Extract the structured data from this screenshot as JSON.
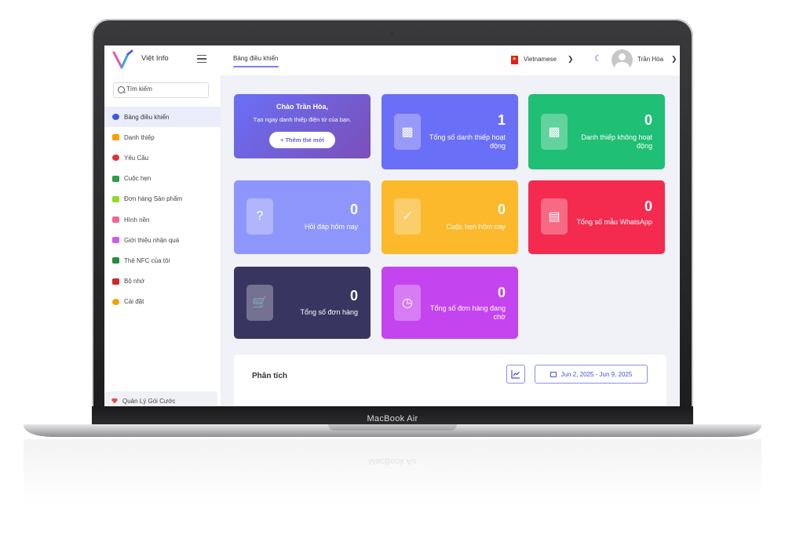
{
  "device": {
    "label": "MacBook Air"
  },
  "topbar": {
    "app_name": "Việt Info",
    "breadcrumb": "Bảng điều khiển",
    "language": "Vietnamese",
    "user_name": "Trần Hòa"
  },
  "sidebar": {
    "search_placeholder": "Tìm kiếm",
    "items": [
      {
        "label": "Bảng điều khiển",
        "icon": "dashboard-icon",
        "color": "#3b5bdb",
        "active": true
      },
      {
        "label": "Danh thiếp",
        "icon": "card-icon",
        "color": "#f59f00"
      },
      {
        "label": "Yêu Cầu",
        "icon": "request-icon",
        "color": "#e03131"
      },
      {
        "label": "Cuộc hẹn",
        "icon": "calendar-icon",
        "color": "#2f9e44"
      },
      {
        "label": "Đơn hàng Sản phẩm",
        "icon": "order-icon",
        "color": "#94d82d"
      },
      {
        "label": "Hình nền",
        "icon": "wallpaper-icon",
        "color": "#f06595"
      },
      {
        "label": "Giới thiệu nhận quà",
        "icon": "gift-icon",
        "color": "#cc5de8"
      },
      {
        "label": "Thẻ NFC của tôi",
        "icon": "nfc-icon",
        "color": "#2b8a3e"
      },
      {
        "label": "Bộ nhớ",
        "icon": "storage-icon",
        "color": "#c92a2a"
      },
      {
        "label": "Cài đặt",
        "icon": "settings-icon",
        "color": "#f59f00"
      }
    ],
    "plan_label": "Quản Lý Gói Cước"
  },
  "welcome": {
    "title": "Chào Trần Hòa,",
    "subtitle": "Tạo ngay danh thiếp điện tử của bạn.",
    "button": "+ Thêm thẻ mới",
    "color": "#6a63d8"
  },
  "stats": [
    {
      "value": "1",
      "label": "Tổng số danh thiếp hoạt động",
      "icon": "id-badge-icon",
      "color": "#6a6ff7"
    },
    {
      "value": "0",
      "label": "Danh thiếp không hoạt động",
      "icon": "id-badge-icon",
      "color": "#1fbf75"
    },
    {
      "value": "0",
      "label": "Hỏi đáp hôm nay",
      "icon": "question-icon",
      "color": "#8f96fb"
    },
    {
      "value": "0",
      "label": "Cuộc hẹn hôm nay",
      "icon": "calendar-check-icon",
      "color": "#fbb92b"
    },
    {
      "value": "0",
      "label": "Tổng số mẫu WhatsApp",
      "icon": "document-icon",
      "color": "#f52a4f"
    },
    {
      "value": "0",
      "label": "Tổng số đơn hàng",
      "icon": "cart-icon",
      "color": "#383660"
    },
    {
      "value": "0",
      "label": "Tổng số đơn hàng đang chờ",
      "icon": "clock-icon",
      "color": "#c445f0"
    }
  ],
  "analysis": {
    "title": "Phân tích",
    "date_range": "Jun 2, 2025 - Jun 9, 2025"
  }
}
